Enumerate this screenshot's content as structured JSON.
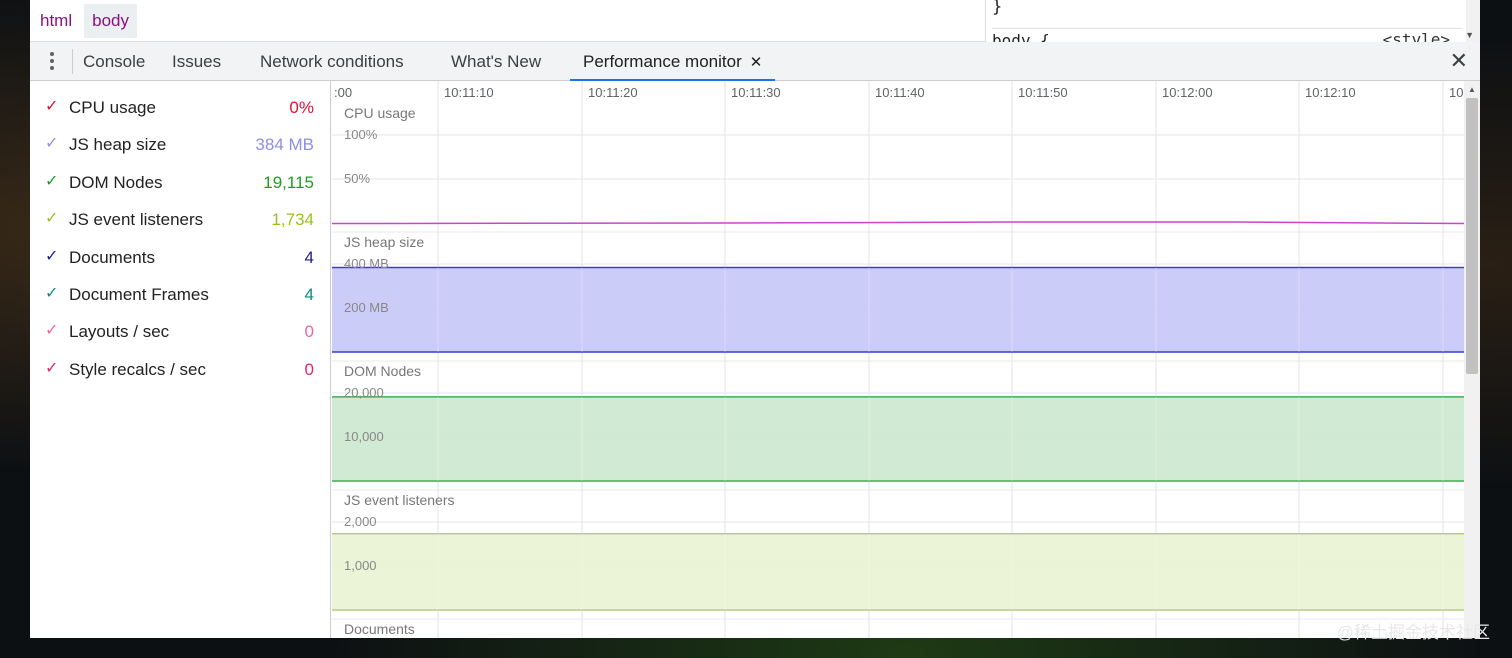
{
  "breadcrumb": [
    {
      "label": "html"
    },
    {
      "label": "body"
    }
  ],
  "styles_pane": {
    "closing_brace": "}",
    "rule_selector": "body {",
    "rule_source": "<style>"
  },
  "drawer": {
    "tabs": [
      {
        "label": "Console",
        "active": false
      },
      {
        "label": "Issues",
        "active": false
      },
      {
        "label": "Network conditions",
        "active": false
      },
      {
        "label": "What's New",
        "active": false
      },
      {
        "label": "Performance monitor",
        "active": true
      }
    ],
    "close_tab_glyph": "✕",
    "close_drawer_glyph": "✕"
  },
  "metrics": [
    {
      "label": "CPU usage",
      "value": "0%",
      "color": "#e0123a",
      "checked": true
    },
    {
      "label": "JS heap size",
      "value": "384 MB",
      "color": "#8f8fe3",
      "checked": true
    },
    {
      "label": "DOM Nodes",
      "value": "19,115",
      "color": "#1e9e1e",
      "checked": true
    },
    {
      "label": "JS event listeners",
      "value": "1,734",
      "color": "#9ac21f",
      "checked": true
    },
    {
      "label": "Documents",
      "value": "4",
      "color": "#1d1d8c",
      "checked": true
    },
    {
      "label": "Document Frames",
      "value": "4",
      "color": "#118a7e",
      "checked": true
    },
    {
      "label": "Layouts / sec",
      "value": "0",
      "color": "#ee66aa",
      "checked": true
    },
    {
      "label": "Style recalcs / sec",
      "value": "0",
      "color": "#e8246f",
      "checked": true
    }
  ],
  "timeline": {
    "time_labels": [
      ":00",
      "10:11:10",
      "10:11:20",
      "10:11:30",
      "10:11:40",
      "10:11:50",
      "10:12:00",
      "10:12:10",
      "10:"
    ]
  },
  "panels": [
    {
      "title": "CPU usage",
      "axis_labels": [
        "100%",
        "50%"
      ],
      "color": "#cc44cc",
      "fill": "none",
      "level": 0.0
    },
    {
      "title": "JS heap size",
      "axis_labels": [
        "400 MB",
        "200 MB"
      ],
      "color": "#3b3bd9",
      "fill": "#c7c7f7",
      "level": 384,
      "max": 400
    },
    {
      "title": "DOM Nodes",
      "axis_labels": [
        "20,000",
        "10,000"
      ],
      "color": "#3fae52",
      "fill": "#cbe8cf",
      "level": 19115,
      "max": 20000
    },
    {
      "title": "JS event listeners",
      "axis_labels": [
        "2,000",
        "1,000"
      ],
      "color": "#b7cc7d",
      "fill": "#eaf3d3",
      "level": 1734,
      "max": 2000
    },
    {
      "title": "Documents",
      "axis_labels": [],
      "color": "#1d1d8c",
      "fill": "none"
    }
  ],
  "watermark": "@稀土掘金技术社区"
}
